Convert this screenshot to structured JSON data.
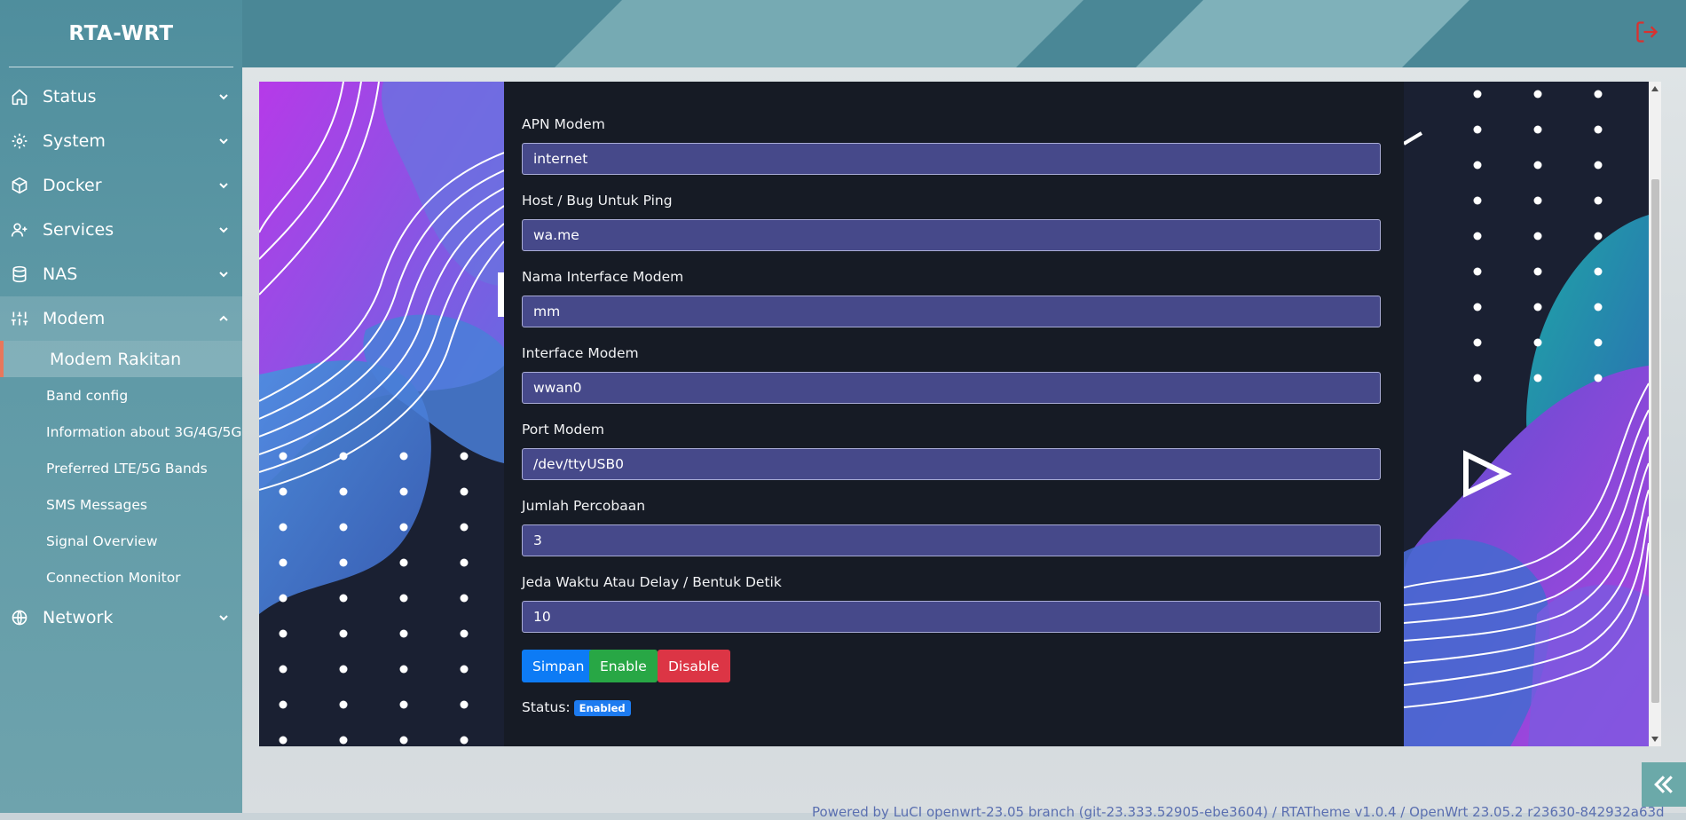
{
  "app": {
    "title": "RTA-WRT"
  },
  "sidebar": {
    "items": [
      {
        "label": "Status",
        "icon": "home-icon"
      },
      {
        "label": "System",
        "icon": "gear-icon"
      },
      {
        "label": "Docker",
        "icon": "box-icon"
      },
      {
        "label": "Services",
        "icon": "user-plus-icon"
      },
      {
        "label": "NAS",
        "icon": "database-icon"
      },
      {
        "label": "Modem",
        "icon": "sliders-icon",
        "expanded": true
      },
      {
        "label": "Network",
        "icon": "globe-icon"
      }
    ],
    "modem_submenu": [
      "Modem Rakitan",
      "Band config",
      "Information about 3G/4G/5G",
      "Preferred LTE/5G Bands",
      "SMS Messages",
      "Signal Overview",
      "Connection Monitor"
    ],
    "active_submenu": "Modem Rakitan"
  },
  "header": {
    "logout_icon": "logout-icon",
    "logout_color": "#d9312f"
  },
  "form": {
    "fields": [
      {
        "label": "APN Modem",
        "value": "internet"
      },
      {
        "label": "Host / Bug Untuk Ping",
        "value": "wa.me"
      },
      {
        "label": "Nama Interface Modem",
        "value": "mm"
      },
      {
        "label": "Interface Modem",
        "value": "wwan0"
      },
      {
        "label": "Port Modem",
        "value": "/dev/ttyUSB0"
      },
      {
        "label": "Jumlah Percobaan",
        "value": "3"
      },
      {
        "label": "Jeda Waktu Atau Delay / Bentuk Detik",
        "value": "10"
      }
    ],
    "buttons": {
      "save": "Simpan",
      "enable": "Enable",
      "disable": "Disable"
    },
    "status_label": "Status:",
    "status_value": "Enabled"
  },
  "colors": {
    "save": "#0d7bf5",
    "enable": "#28a745",
    "disable": "#dc3545",
    "field_bg": "#46498a",
    "accent": "#e8775c"
  },
  "footer": {
    "text": "Powered by LuCI openwrt-23.05 branch (git-23.333.52905-ebe3604) / RTATheme v1.0.4 / OpenWrt 23.05.2 r23630-842932a63d"
  }
}
